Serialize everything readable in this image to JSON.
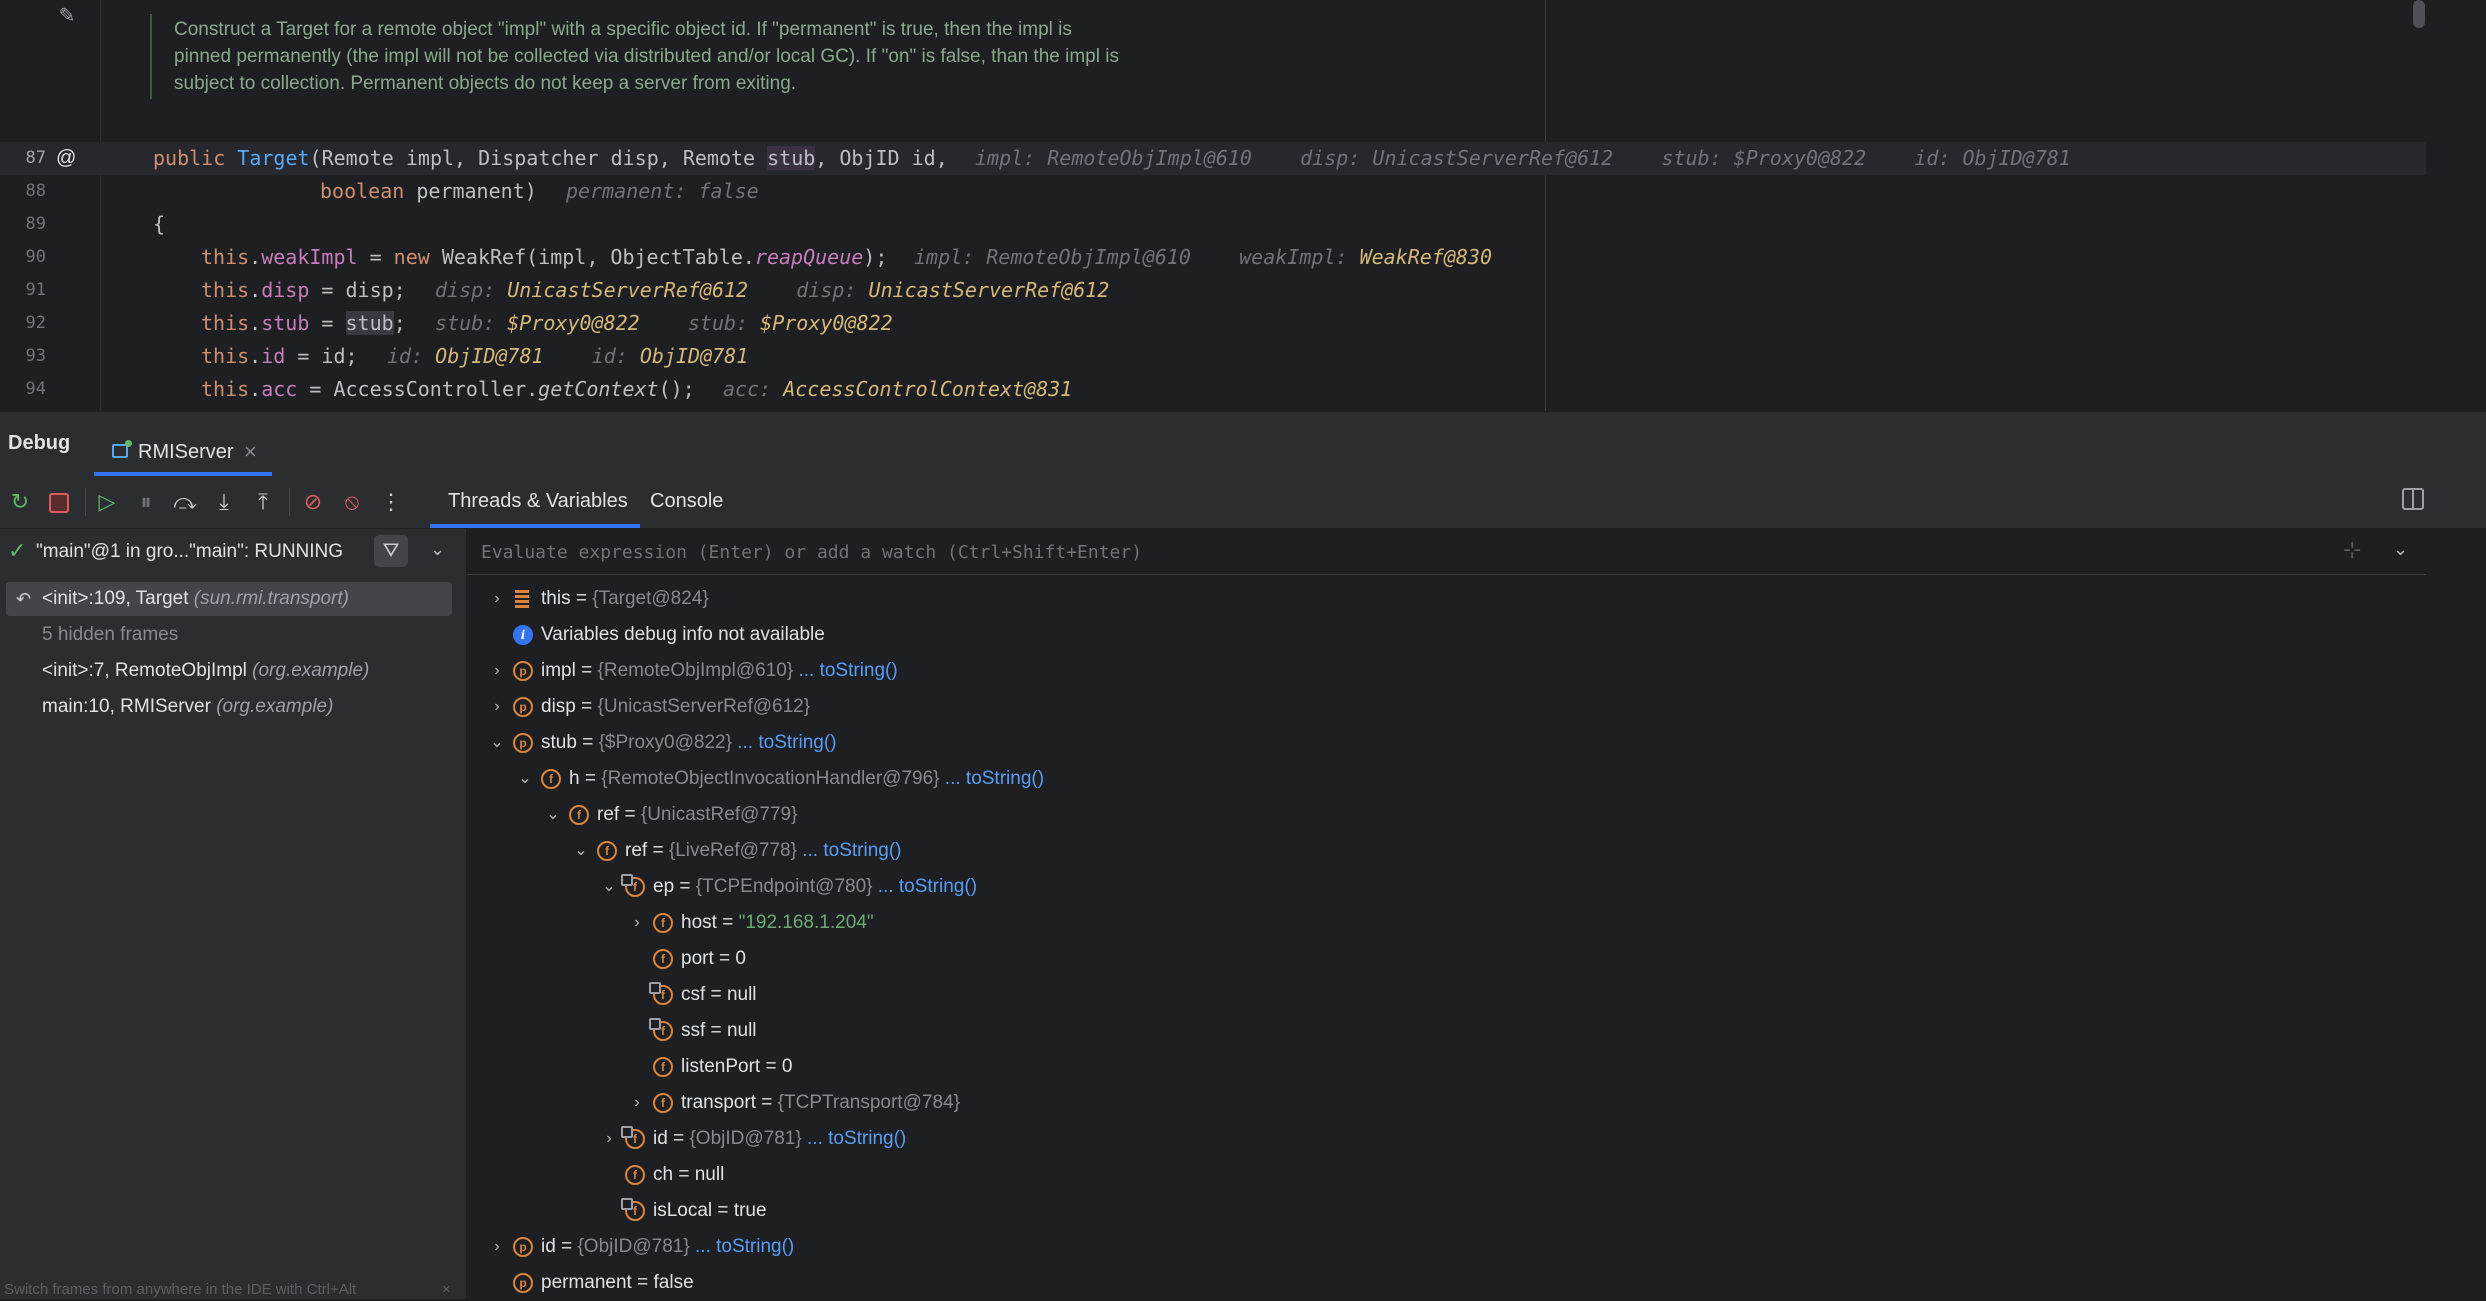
{
  "editor": {
    "doc_comment": "Construct a Target for a remote object \"impl\" with a specific object id. If \"permanent\" is true, then the impl is pinned permanently (the impl will not be collected via distributed and/or local GC). If \"on\" is false, than the impl is subject to collection. Permanent objects do not keep a server from exiting.",
    "lines": {
      "l87": {
        "num": "87",
        "kw": "public",
        "name": "Target",
        "p1": "(Remote impl, Dispatcher disp, Remote ",
        "stub": "stub",
        "p2": ", ObjID id,",
        "h1n": "impl:",
        "h1v": "RemoteObjImpl@610",
        "h2n": "disp:",
        "h2v": "UnicastServerRef@612",
        "h3n": "stub:",
        "h3v": "$Proxy0@822",
        "h4n": "id:",
        "h4v": "ObjID@781"
      },
      "l88": {
        "num": "88",
        "kw": "boolean",
        "rest": " permanent)",
        "hn": "permanent:",
        "hv": "false"
      },
      "l89": {
        "num": "89",
        "text": "{"
      },
      "l90": {
        "num": "90",
        "this": "this",
        "field": "weakImpl",
        "eq": " = ",
        "kw": "new",
        "rest": " WeakRef(impl, ObjectTable.",
        "method": "reapQueue",
        "end": ");",
        "h1n": "impl:",
        "h1v": "RemoteObjImpl@610",
        "h2n": "weakImpl:",
        "h2v": "WeakRef@830"
      },
      "l91": {
        "num": "91",
        "this": "this",
        "field": "disp",
        "rest": " = disp;",
        "h1n": "disp:",
        "h1v": "UnicastServerRef@612",
        "h2n": "disp:",
        "h2v": "UnicastServerRef@612"
      },
      "l92": {
        "num": "92",
        "this": "this",
        "field": "stub",
        "eq": " = ",
        "hl": "stub",
        "end": ";",
        "h1n": "stub:",
        "h1v": "$Proxy0@822",
        "h2n": "stub:",
        "h2v": "$Proxy0@822"
      },
      "l93": {
        "num": "93",
        "this": "this",
        "field": "id",
        "rest": " = id;",
        "h1n": "id:",
        "h1v": "ObjID@781",
        "h2n": "id:",
        "h2v": "ObjID@781"
      },
      "l94": {
        "num": "94",
        "this": "this",
        "field": "acc",
        "rest": " = AccessController.",
        "method": "getContext",
        "end": "();",
        "h1n": "acc:",
        "h1v": "AccessControlContext@831"
      }
    }
  },
  "debug": {
    "title": "Debug",
    "run_tab": "RMIServer",
    "tabs": {
      "threads": "Threads & Variables",
      "console": "Console"
    },
    "thread": "\"main\"@1 in gro...\"main\": RUNNING",
    "eval_placeholder": "Evaluate expression (Enter) or add a watch (Ctrl+Shift+Enter)",
    "frames": [
      {
        "name": "<init>:109, Target ",
        "pkg": "(sun.rmi.transport)"
      },
      {
        "hidden": "5 hidden frames"
      },
      {
        "name": "<init>:7, RemoteObjImpl ",
        "pkg": "(org.example)"
      },
      {
        "name": "main:10, RMIServer ",
        "pkg": "(org.example)"
      }
    ],
    "footer": "Switch frames from anywhere in the IDE with Ctrl+Alt"
  },
  "variables": [
    {
      "name": "this",
      "eq": " = ",
      "type": "{Target@824}"
    },
    {
      "info": "Variables debug info not available"
    },
    {
      "name": "impl",
      "eq": " = ",
      "type": "{RemoteObjImpl@610}",
      "link": "... toString()"
    },
    {
      "name": "disp",
      "eq": " = ",
      "type": "{UnicastServerRef@612}"
    },
    {
      "name": "stub",
      "eq": " = ",
      "type": "{$Proxy0@822}",
      "link": "... toString()"
    },
    {
      "name": "h",
      "eq": " = ",
      "type": "{RemoteObjectInvocationHandler@796}",
      "link": "... toString()"
    },
    {
      "name": "ref",
      "eq": " = ",
      "type": "{UnicastRef@779}"
    },
    {
      "name": "ref",
      "eq": " = ",
      "type": "{LiveRef@778}",
      "link": "... toString()"
    },
    {
      "name": "ep",
      "eq": " = ",
      "type": "{TCPEndpoint@780}",
      "link": "... toString()"
    },
    {
      "name": "host",
      "eq": " = ",
      "str": "\"192.168.1.204\""
    },
    {
      "name": "port",
      "eq": " = ",
      "plain": "0"
    },
    {
      "name": "csf",
      "eq": " = ",
      "plain": "null"
    },
    {
      "name": "ssf",
      "eq": " = ",
      "plain": "null"
    },
    {
      "name": "listenPort",
      "eq": " = ",
      "plain": "0"
    },
    {
      "name": "transport",
      "eq": " = ",
      "type": "{TCPTransport@784}"
    },
    {
      "name": "id",
      "eq": " = ",
      "type": "{ObjID@781}",
      "link": "... toString()"
    },
    {
      "name": "ch",
      "eq": " = ",
      "plain": "null"
    },
    {
      "name": "isLocal",
      "eq": " = ",
      "plain": "true"
    },
    {
      "name": "id",
      "eq": " = ",
      "type": "{ObjID@781}",
      "link": "... toString()"
    },
    {
      "name": "permanent",
      "eq": " = ",
      "plain": "false"
    }
  ],
  "icons": [
    "pencil-icon",
    "annotation-at-icon",
    "rerun-icon",
    "stop-icon",
    "resume-icon",
    "pause-icon",
    "step-over-icon",
    "step-into-icon",
    "step-out-icon",
    "breakpoints-icon",
    "mute-breakpoints-icon",
    "more-icon",
    "layout-icon",
    "check-icon",
    "filter-icon",
    "back-icon",
    "info-icon"
  ],
  "colors": {
    "accent": "#3574f0",
    "keyword": "#cf8e6d",
    "string": "#6aab73",
    "hint_value": "#d5b778",
    "field_icon": "#d9853b"
  }
}
